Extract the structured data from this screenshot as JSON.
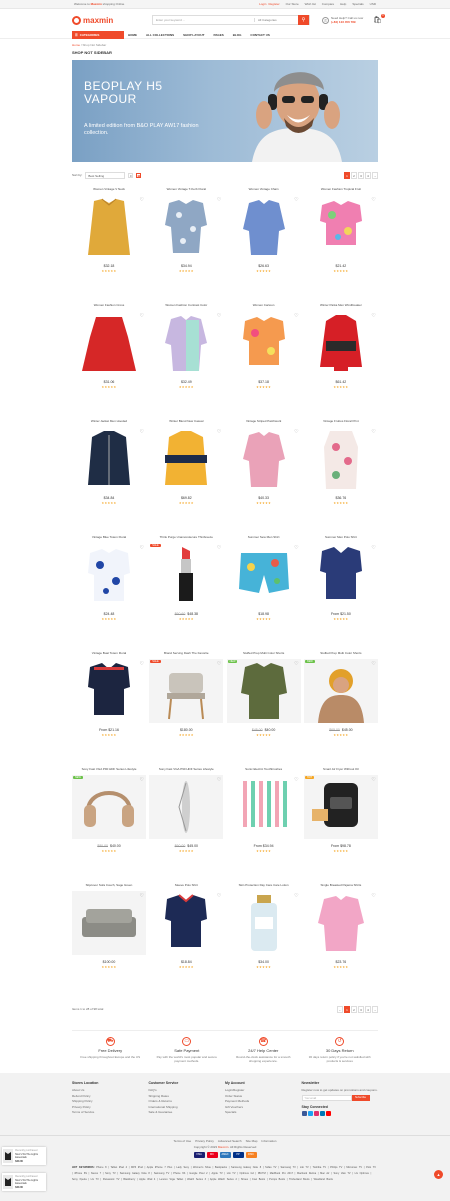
{
  "topbar": {
    "welcome_prefix": "Welcome to ",
    "welcome_brand": "Maxmin",
    "welcome_suffix": " shopping Online",
    "login": "Login",
    "or": "or",
    "register": "Register",
    "links": [
      "Our Store",
      "Wish list",
      "Compare",
      "Help",
      "Specials"
    ],
    "currency": "USD"
  },
  "header": {
    "logo": "maxmin",
    "search_placeholder": "Enter your keyword ...",
    "category": "All Categories",
    "hotline_label": "Need Help? Call us now",
    "hotline_number": "(+84) 123 456 789",
    "cart_count": "0"
  },
  "nav": {
    "categories": "CATEGORIES",
    "items": [
      "HOME",
      "ALL COLLECTIONS",
      "SHOP LAYOUT",
      "PAGES",
      "BLOG",
      "CONTACT US"
    ]
  },
  "breadcrumb": {
    "home": "Home",
    "sep": "/",
    "current": "Shop Not Sidebar"
  },
  "page_title": "SHOP NOT SIDEBAR",
  "banner": {
    "heading_line1": "BEOPLAY H5",
    "heading_line2": "VAPOUR",
    "text": "A limited edition from B&O PLAY AW17 fashion collection."
  },
  "toolbar": {
    "sort_label": "Sort by:",
    "sort_value": "Best Selling",
    "pages": [
      "1",
      "2",
      "3",
      "4",
      "→"
    ]
  },
  "products": [
    {
      "name": "Women Vintage V Neck",
      "price": "$32.18",
      "old": "",
      "rating": "★★★★★",
      "tag": ""
    },
    {
      "name": "Women Vintage T-Kerb Floral",
      "price": "$34.94",
      "old": "",
      "rating": "★★★★★",
      "tag": ""
    },
    {
      "name": "Women Vintage Chain",
      "price": "$26.63",
      "old": "",
      "rating": "★★★★★",
      "tag": ""
    },
    {
      "name": "Women Fashion Tropical Fruit",
      "price": "$21.42",
      "old": "",
      "rating": "★★★★★",
      "tag": ""
    },
    {
      "name": "Women Fashion Cross",
      "price": "$31.06",
      "old": "",
      "rating": "★★★★★",
      "tag": ""
    },
    {
      "name": "Women Fashion Contrast Color",
      "price": "$32.49",
      "old": "",
      "rating": "★★★★★",
      "tag": ""
    },
    {
      "name": "Women Cartoon",
      "price": "$37.18",
      "old": "",
      "rating": "★★★★★",
      "tag": ""
    },
    {
      "name": "Winter Parka Men Windbreaker",
      "price": "$61.42",
      "old": "",
      "rating": "★★★★★",
      "tag": ""
    },
    {
      "name": "Winter Jacket Men Hooded",
      "price": "$34.84",
      "old": "",
      "rating": "★★★★★",
      "tag": ""
    },
    {
      "name": "Winter Blend New Casual",
      "price": "$69.82",
      "old": "",
      "rating": "★★★★★",
      "tag": ""
    },
    {
      "name": "Vintage Striped Patchwork",
      "price": "$40.33",
      "old": "",
      "rating": "★★★★★",
      "tag": ""
    },
    {
      "name": "Vintage Fruttos Floral Print",
      "price": "$36.76",
      "old": "",
      "rating": "★★★★★",
      "tag": ""
    },
    {
      "name": "Vintage Blue Totem Floral",
      "price": "$24.48",
      "old": "",
      "rating": "★★★★★",
      "tag": ""
    },
    {
      "name": "Think Purge Unamorolecure Thinbreeze",
      "price": "$48.38",
      "old": "$60.60",
      "rating": "★★★★★",
      "tag": "sale"
    },
    {
      "name": "Summer Sew Men Shirt",
      "price": "$18.98",
      "old": "",
      "rating": "★★★★★",
      "tag": ""
    },
    {
      "name": "Summer Men Polo Shirt",
      "price": "From $21.50",
      "old": "",
      "rating": "★★★★★",
      "tag": ""
    },
    {
      "name": "Vintage Buat Totem Floral",
      "price": "From $21.16",
      "old": "",
      "rating": "★★★★★",
      "tag": ""
    },
    {
      "name": "Brand Serving Dash The Fanorite",
      "price": "$180.00",
      "old": "",
      "rating": "★★★★★",
      "tag": "sale"
    },
    {
      "name": "Stuffed Prep Multi Color Shorts",
      "price": "$40.00",
      "old": "$45.00",
      "rating": "★★★★★",
      "tag": "new"
    },
    {
      "name": "Stuffed Prep Multi Color Shorts",
      "price": "$45.00",
      "old": "$65.00",
      "rating": "★★★★★",
      "tag": "new"
    },
    {
      "name": "Sony Fast VGA P90 HDF Series Lifestyle",
      "price": "$40.00",
      "old": "$80.00",
      "rating": "★★★★★",
      "tag": "new"
    },
    {
      "name": "Sony Fast VGA P90 HDF Series Lifestyle",
      "price": "$45.00",
      "old": "$60.00",
      "rating": "★★★★★",
      "tag": ""
    },
    {
      "name": "Sonic Electric Toothbrushes",
      "price": "From $34.94",
      "old": "",
      "rating": "★★★★★",
      "tag": ""
    },
    {
      "name": "Smart Air Fryer Without Oil",
      "price": "From $98.78",
      "old": "",
      "rating": "★★★★★",
      "tag": "hot"
    },
    {
      "name": "Slipcover Sofa Couch, Sage Green",
      "price": "$100.00",
      "old": "",
      "rating": "★★★★★",
      "tag": ""
    },
    {
      "name": "Sleeve Polo Shirt",
      "price": "$18.84",
      "old": "",
      "rating": "★★★★★",
      "tag": ""
    },
    {
      "name": "Skin Protection Day Care Care Lotion",
      "price": "$34.00",
      "old": "",
      "rating": "★★★★★",
      "tag": ""
    },
    {
      "name": "Single Breasted Pajama Shirts",
      "price": "$23.76",
      "old": "",
      "rating": "★★★★★",
      "tag": ""
    }
  ],
  "bottom_pager": {
    "text": "Items 1 to 28 of 98 total",
    "pages": [
      "←",
      "1",
      "2",
      "3",
      "4",
      "→"
    ]
  },
  "services": [
    {
      "title": "Free Delivery",
      "desc": "Free shipping throughout Europe and the US"
    },
    {
      "title": "Safe Payment",
      "desc": "Pay with the world's most popular and secure payment methods."
    },
    {
      "title": "24/7 Help Center",
      "desc": "Round-the-clock assistance for a smooth shopping experience."
    },
    {
      "title": "30 Days Return",
      "desc": "30 days return policy if you're not satisfied with products & services"
    }
  ],
  "footer": {
    "cols": [
      {
        "title": "Stores Location",
        "links": [
          "About Us",
          "Refund Policy",
          "Shipping Policy",
          "Privacy Policy",
          "Terms of Service"
        ]
      },
      {
        "title": "Customer Service",
        "links": [
          "FAQ's",
          "Shipping Rates",
          "Orders & Returns",
          "International Shipping",
          "Sale & Guarantee"
        ]
      },
      {
        "title": "My Account",
        "links": [
          "Login/Register",
          "Order Status",
          "Payment Methods",
          "Gift Vouchers",
          "Specials"
        ]
      }
    ],
    "newsletter_title": "Newsletter",
    "newsletter_text": "Register now to get updates on promotions and coupons.",
    "email_placeholder": "Your email",
    "subscribe": "Subscribe",
    "stay": "Stay Connected",
    "bar_links": [
      "Terms of Use",
      "Privacy Policy",
      "Advanced Search",
      "Site Map",
      "Information"
    ],
    "copy_prefix": "Copyright © 2023 ",
    "copy_brand": "Maxmin",
    "copy_suffix": ". All Rights Reserved",
    "payments": [
      "VISA",
      "MC",
      "AMEX",
      "PP",
      "DISC"
    ],
    "tags_title": "HOT KEYWORDS:",
    "tags": "Phone 8 | Tablet iPad 4 | MP3 iPod | Apple iPhone 7 Plus | Lady Sexy | Women's Shoe | Backpacks | Samsung Galaxy Note 8 | Sofas TV | Samsung TV | Lilo TV | Toshiba TV | Philips TV | Micromax TV | Polo TV | iPhone 6S | Nexus 7 | Sony TV | Samsung Galaxy Note 8 | Samsung TV | Phone 6S | Google Pixel 2 | Apple TV | Lilo TV | Optimus G2 | IBCTM | MacBook Pro 2017 | Macbook Retina | Mac Air | Sony Vaio TV | LG Optimus | Sony Xperia | LG TV | Panasonic TV | Blackberry | Apple iPad 4 | Lenovo Yoga Tablet | Watch Series 3 | Apple Watch Series 2 | Shoes | Cow Boots | Pumps Boots | Timberland Boots | Woodland Boots"
  },
  "popups": [
    {
      "label": "Recently purchased",
      "title": "Men's Wi-The Lights Essentials",
      "price": "$40.00"
    },
    {
      "label": "Recently purchased",
      "title": "Men's Wi-The Lights Essentials",
      "price": "$40.00"
    }
  ],
  "colors": {
    "accent": "#ef4a2a",
    "rating": "#f5a623",
    "new_badge": "#6cc24a"
  }
}
